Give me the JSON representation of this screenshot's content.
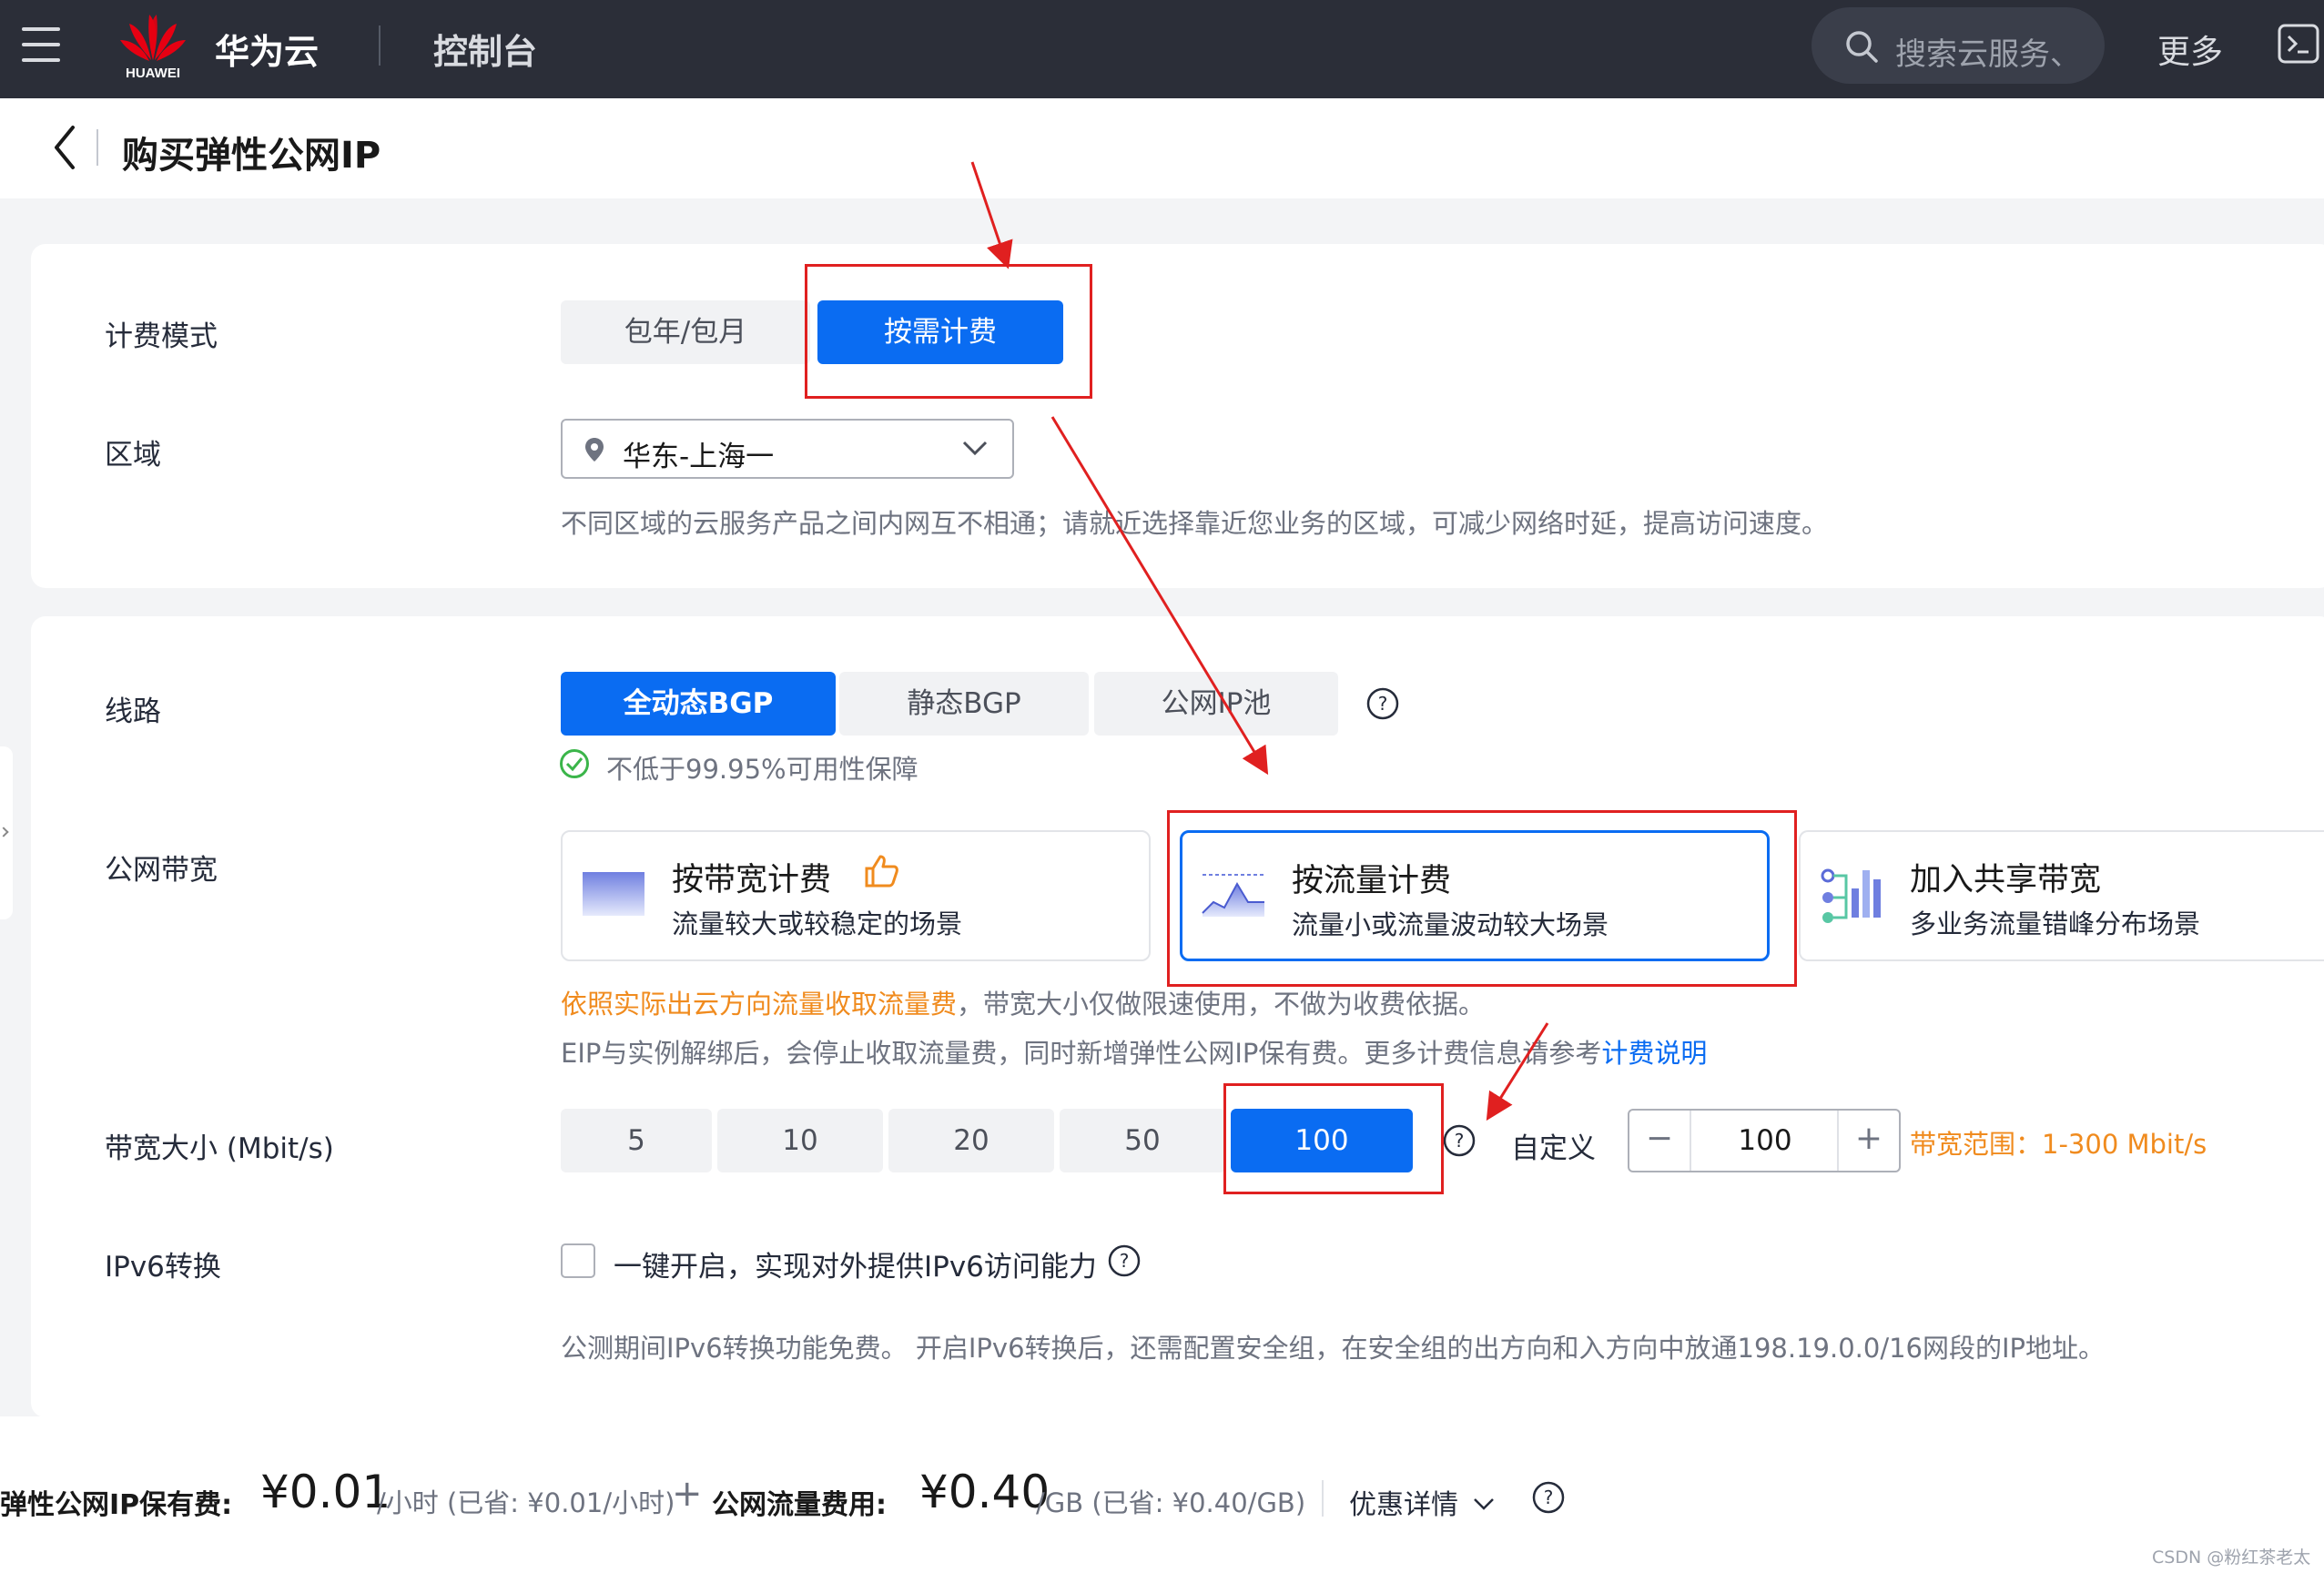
{
  "topbar": {
    "logo_text": "HUAWEI",
    "brand": "华为云",
    "console": "控制台",
    "search_placeholder": "搜索云服务、",
    "more": "更多",
    "brand_color": "#e60012"
  },
  "header": {
    "title": "购买弹性公网IP"
  },
  "billing": {
    "label": "计费模式",
    "options": [
      "包年/包月",
      "按需计费"
    ],
    "selected": "按需计费"
  },
  "region": {
    "label": "区域",
    "value": "华东-上海一",
    "hint": "不同区域的云服务产品之间内网互不相通；请就近选择靠近您业务的区域，可减少网络时延，提高访问速度。"
  },
  "line": {
    "label": "线路",
    "options": [
      "全动态BGP",
      "静态BGP",
      "公网IP池"
    ],
    "selected": "全动态BGP",
    "guarantee": "不低于99.95%可用性保障"
  },
  "bandwidth_type": {
    "label": "公网带宽",
    "options": [
      {
        "title": "按带宽计费",
        "subtitle": "流量较大或较稳定的场景"
      },
      {
        "title": "按流量计费",
        "subtitle": "流量小或流量波动较大场景"
      },
      {
        "title": "加入共享带宽",
        "subtitle": "多业务流量错峰分布场景"
      }
    ],
    "selected": "按流量计费",
    "note_highlight": "依照实际出云方向流量收取流量费",
    "note_rest": "，带宽大小仅做限速使用，不做为收费依据。",
    "note2": "EIP与实例解绑后，会停止收取流量费，同时新增弹性公网IP保有费。更多计费信息请参考",
    "note2_link": "计费说明"
  },
  "bandwidth_size": {
    "label": "带宽大小 (Mbit/s)",
    "options": [
      "5",
      "10",
      "20",
      "50",
      "100"
    ],
    "selected": "100",
    "custom_label": "自定义",
    "custom_value": "100",
    "minus": "−",
    "plus": "+",
    "range": "带宽范围：1-300 Mbit/s"
  },
  "ipv6": {
    "label": "IPv6转换",
    "checkbox_label": "一键开启，实现对外提供IPv6访问能力",
    "checked": false,
    "hint": "公测期间IPv6转换功能免费。 开启IPv6转换后，还需配置安全组，在安全组的出方向和入方向中放通198.19.0.0/16网段的IP地址。"
  },
  "price": {
    "retain_label": "弹性公网IP保有费:",
    "retain_amount": "¥0.01",
    "retain_unit": "/小时 (已省: ¥0.01/小时)",
    "plus": "+",
    "traffic_label": "公网流量费用:",
    "traffic_amount": "¥0.40",
    "traffic_unit": "/GB (已省: ¥0.40/GB)",
    "promo": "优惠详情"
  },
  "watermark": "CSDN @粉红茶老太",
  "colors": {
    "accent": "#0a6cf2",
    "warning": "#f08b1e",
    "annotation": "#e02020"
  }
}
